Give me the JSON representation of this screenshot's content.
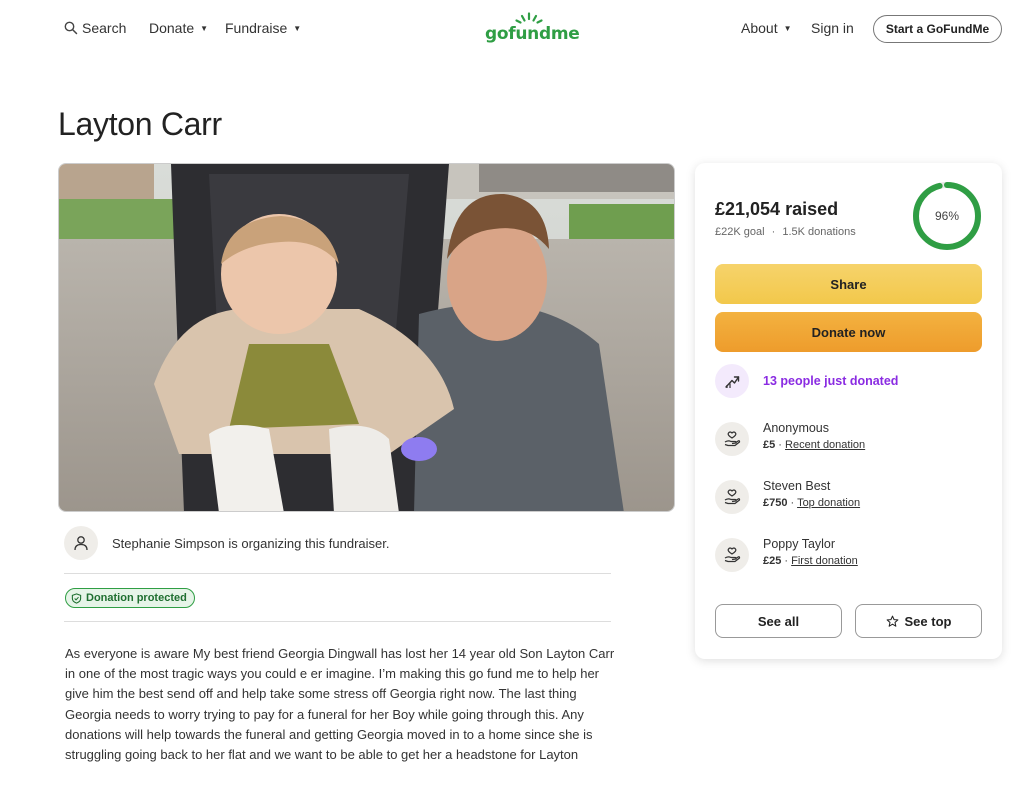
{
  "header": {
    "search_label": "Search",
    "donate_label": "Donate",
    "fundraise_label": "Fundraise",
    "logo_text": "gofundme",
    "about_label": "About",
    "signin_label": "Sign in",
    "start_label": "Start a GoFundMe"
  },
  "campaign": {
    "title": "Layton Carr",
    "organizer_text": "Stephanie Simpson is organizing this fundraiser.",
    "badge_label": "Donation protected",
    "story": "As everyone is aware My best friend Georgia Dingwall has lost her 14 year old Son Layton Carr in one of the most tragic ways you could e er imagine. I’m making this go fund me to help her give him the best send off and help take some stress off Georgia right now. The last thing Georgia needs to worry trying to pay for a funeral for her Boy while going through this. Any donations will help towards the funeral and getting Georgia moved in to a home since she is struggling going back to her flat and we want to be able to get her a headstone for Layton"
  },
  "progress": {
    "raised": "£21,054 raised",
    "goal": "£22K goal",
    "separator": "·",
    "donations": "1.5K donations",
    "percent_label": "96%",
    "percent_value": 0.96,
    "ring_color": "#2f9e44"
  },
  "actions": {
    "share_label": "Share",
    "donate_label": "Donate now"
  },
  "activity": {
    "trend_text": "13 people just donated",
    "donors": [
      {
        "name": "Anonymous",
        "amount": "£5",
        "sep": " · ",
        "tag": "Recent donation"
      },
      {
        "name": "Steven Best",
        "amount": "£750",
        "sep": " · ",
        "tag": "Top donation"
      },
      {
        "name": "Poppy Taylor",
        "amount": "£25",
        "sep": " · ",
        "tag": "First donation"
      }
    ],
    "see_all_label": "See all",
    "see_top_label": "See top"
  },
  "colors": {
    "brand_green": "#2f9e44",
    "share_yellow": "#f2c84b",
    "donate_orange": "#ee9c2c",
    "trend_purple": "#8a2be2"
  }
}
